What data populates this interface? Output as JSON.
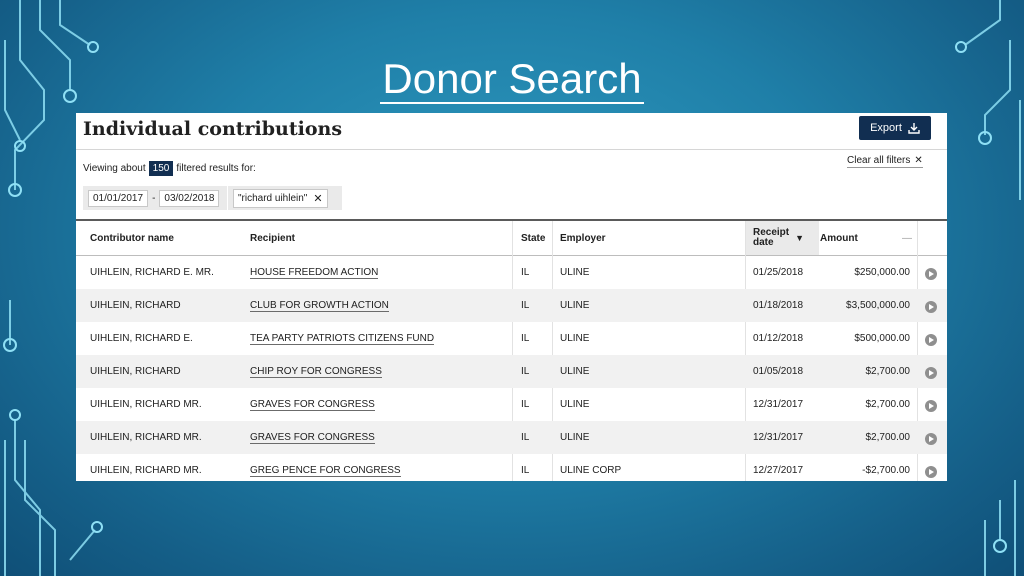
{
  "slide": {
    "title": "Donor Search"
  },
  "app": {
    "page_title": "Individual contributions",
    "export_label": "Export",
    "viewing_prefix": "Viewing about",
    "result_count": "150",
    "viewing_suffix": "filtered results for:",
    "clear_filters_label": "Clear all filters",
    "filters": {
      "date_from": "01/01/2017",
      "date_sep": "-",
      "date_to": "03/02/2018",
      "name": "\"richard uihlein\""
    },
    "columns": {
      "contributor": "Contributor name",
      "recipient": "Recipient",
      "state": "State",
      "employer": "Employer",
      "receipt_date_1": "Receipt",
      "receipt_date_2": "date",
      "amount": "Amount",
      "amount_extra": "—"
    },
    "rows": [
      {
        "contributor": "UIHLEIN, RICHARD E. MR.",
        "recipient": "HOUSE FREEDOM ACTION",
        "state": "IL",
        "employer": "ULINE",
        "date": "01/25/2018",
        "amount": "$250,000.00"
      },
      {
        "contributor": "UIHLEIN, RICHARD",
        "recipient": "CLUB FOR GROWTH ACTION",
        "state": "IL",
        "employer": "ULINE",
        "date": "01/18/2018",
        "amount": "$3,500,000.00"
      },
      {
        "contributor": "UIHLEIN, RICHARD E.",
        "recipient": "TEA PARTY PATRIOTS CITIZENS FUND",
        "state": "IL",
        "employer": "ULINE",
        "date": "01/12/2018",
        "amount": "$500,000.00"
      },
      {
        "contributor": "UIHLEIN, RICHARD",
        "recipient": "CHIP ROY FOR CONGRESS",
        "state": "IL",
        "employer": "ULINE",
        "date": "01/05/2018",
        "amount": "$2,700.00"
      },
      {
        "contributor": "UIHLEIN, RICHARD MR.",
        "recipient": "GRAVES FOR CONGRESS",
        "state": "IL",
        "employer": "ULINE",
        "date": "12/31/2017",
        "amount": "$2,700.00"
      },
      {
        "contributor": "UIHLEIN, RICHARD MR.",
        "recipient": "GRAVES FOR CONGRESS",
        "state": "IL",
        "employer": "ULINE",
        "date": "12/31/2017",
        "amount": "$2,700.00"
      },
      {
        "contributor": "UIHLEIN, RICHARD MR.",
        "recipient": "GREG PENCE FOR CONGRESS",
        "state": "IL",
        "employer": "ULINE CORP",
        "date": "12/27/2017",
        "amount": "-$2,700.00"
      }
    ]
  },
  "colors": {
    "navy": "#112e51",
    "slide_bg": "#1f7fa8",
    "circuit": "#7fd8f0"
  },
  "icons": {
    "export": "download-icon",
    "clear": "close-icon",
    "sort": "sort-desc-icon",
    "row_action": "play-circle-icon"
  }
}
